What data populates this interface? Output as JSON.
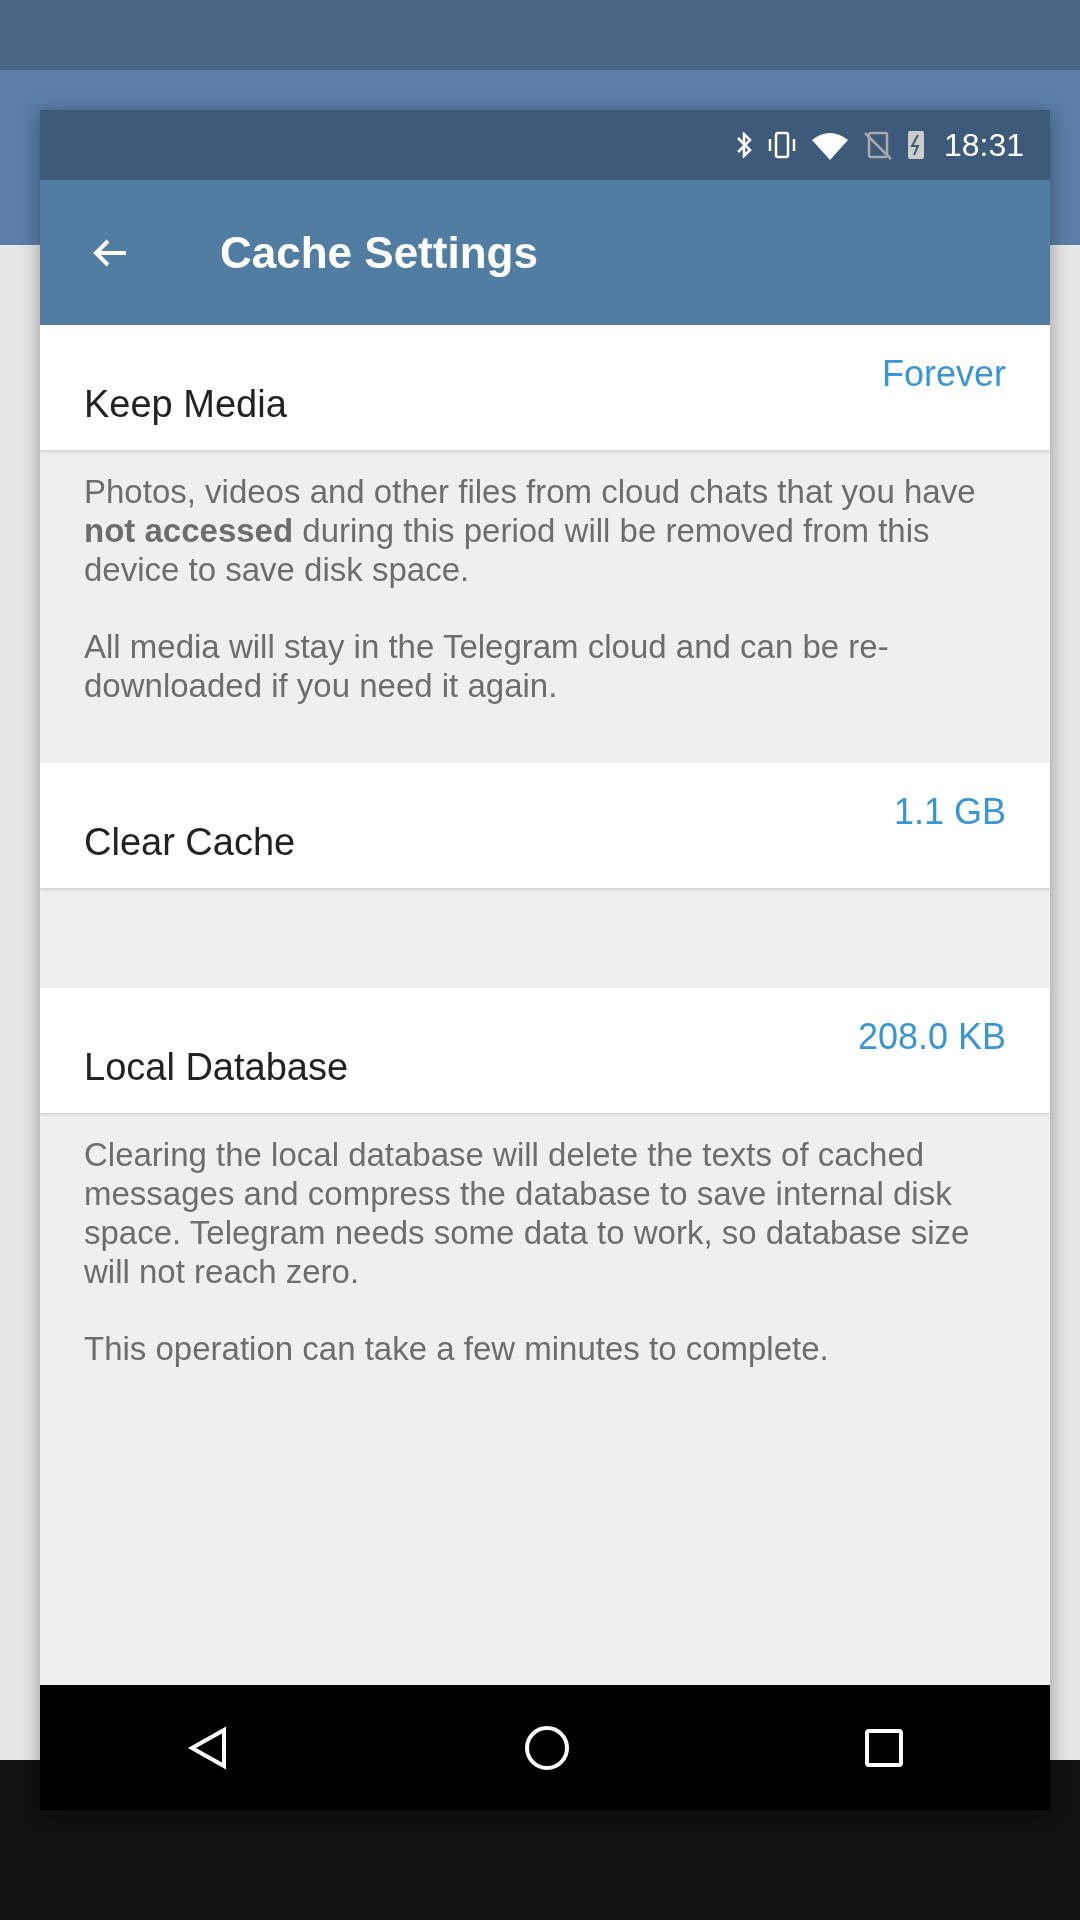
{
  "status_bar": {
    "time": "18:31"
  },
  "app_bar": {
    "title": "Cache Settings"
  },
  "items": [
    {
      "kind": "row",
      "label": "Keep Media",
      "value": "Forever"
    },
    {
      "kind": "note",
      "paragraphs": [
        "Photos, videos and other files from cloud chats that you have **not accessed** during this period will be removed from this device to save disk space.",
        "All media will stay in the Telegram cloud and can be re-downloaded if you need it again."
      ]
    },
    {
      "kind": "row",
      "label": "Clear Cache",
      "value": "1.1 GB"
    },
    {
      "kind": "row",
      "label": "Local Database",
      "value": "208.0 KB"
    },
    {
      "kind": "note",
      "paragraphs": [
        "Clearing the local database will delete the texts of cached messages and compress the database to save internal disk space. Telegram needs some data to work, so database size will not reach zero.",
        "This operation can take a few minutes to complete."
      ]
    }
  ]
}
